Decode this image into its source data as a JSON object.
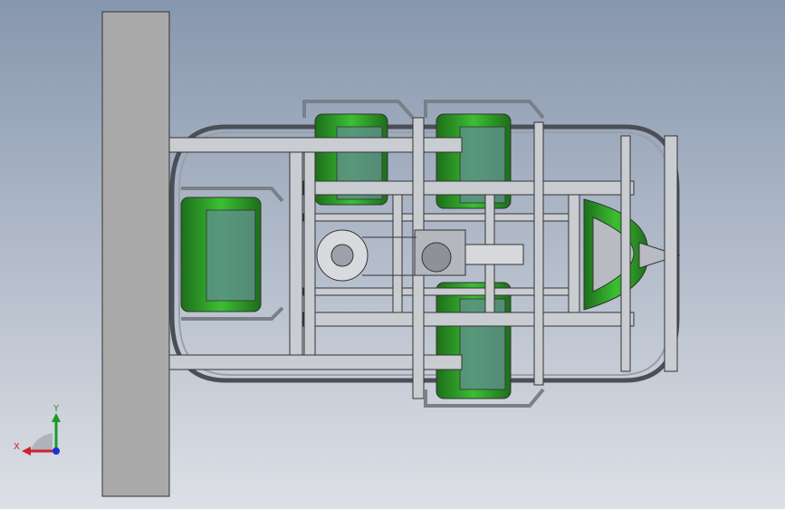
{
  "viewport": {
    "background_top": "#8797ae",
    "background_bottom": "#dde0e6",
    "model_colors": {
      "plate": "#a9a9a9",
      "frame": "#c9ccd1",
      "frame_edge": "#3a3a3a",
      "seat": "#2fa52a",
      "seat_dark": "#1d6e1a",
      "glass": "#5f8f8c"
    }
  },
  "triad": {
    "x_label": "X",
    "y_label": "Y",
    "x_color": "#d0202a",
    "y_color": "#1a9a2a",
    "z_color": "#2030d0"
  }
}
